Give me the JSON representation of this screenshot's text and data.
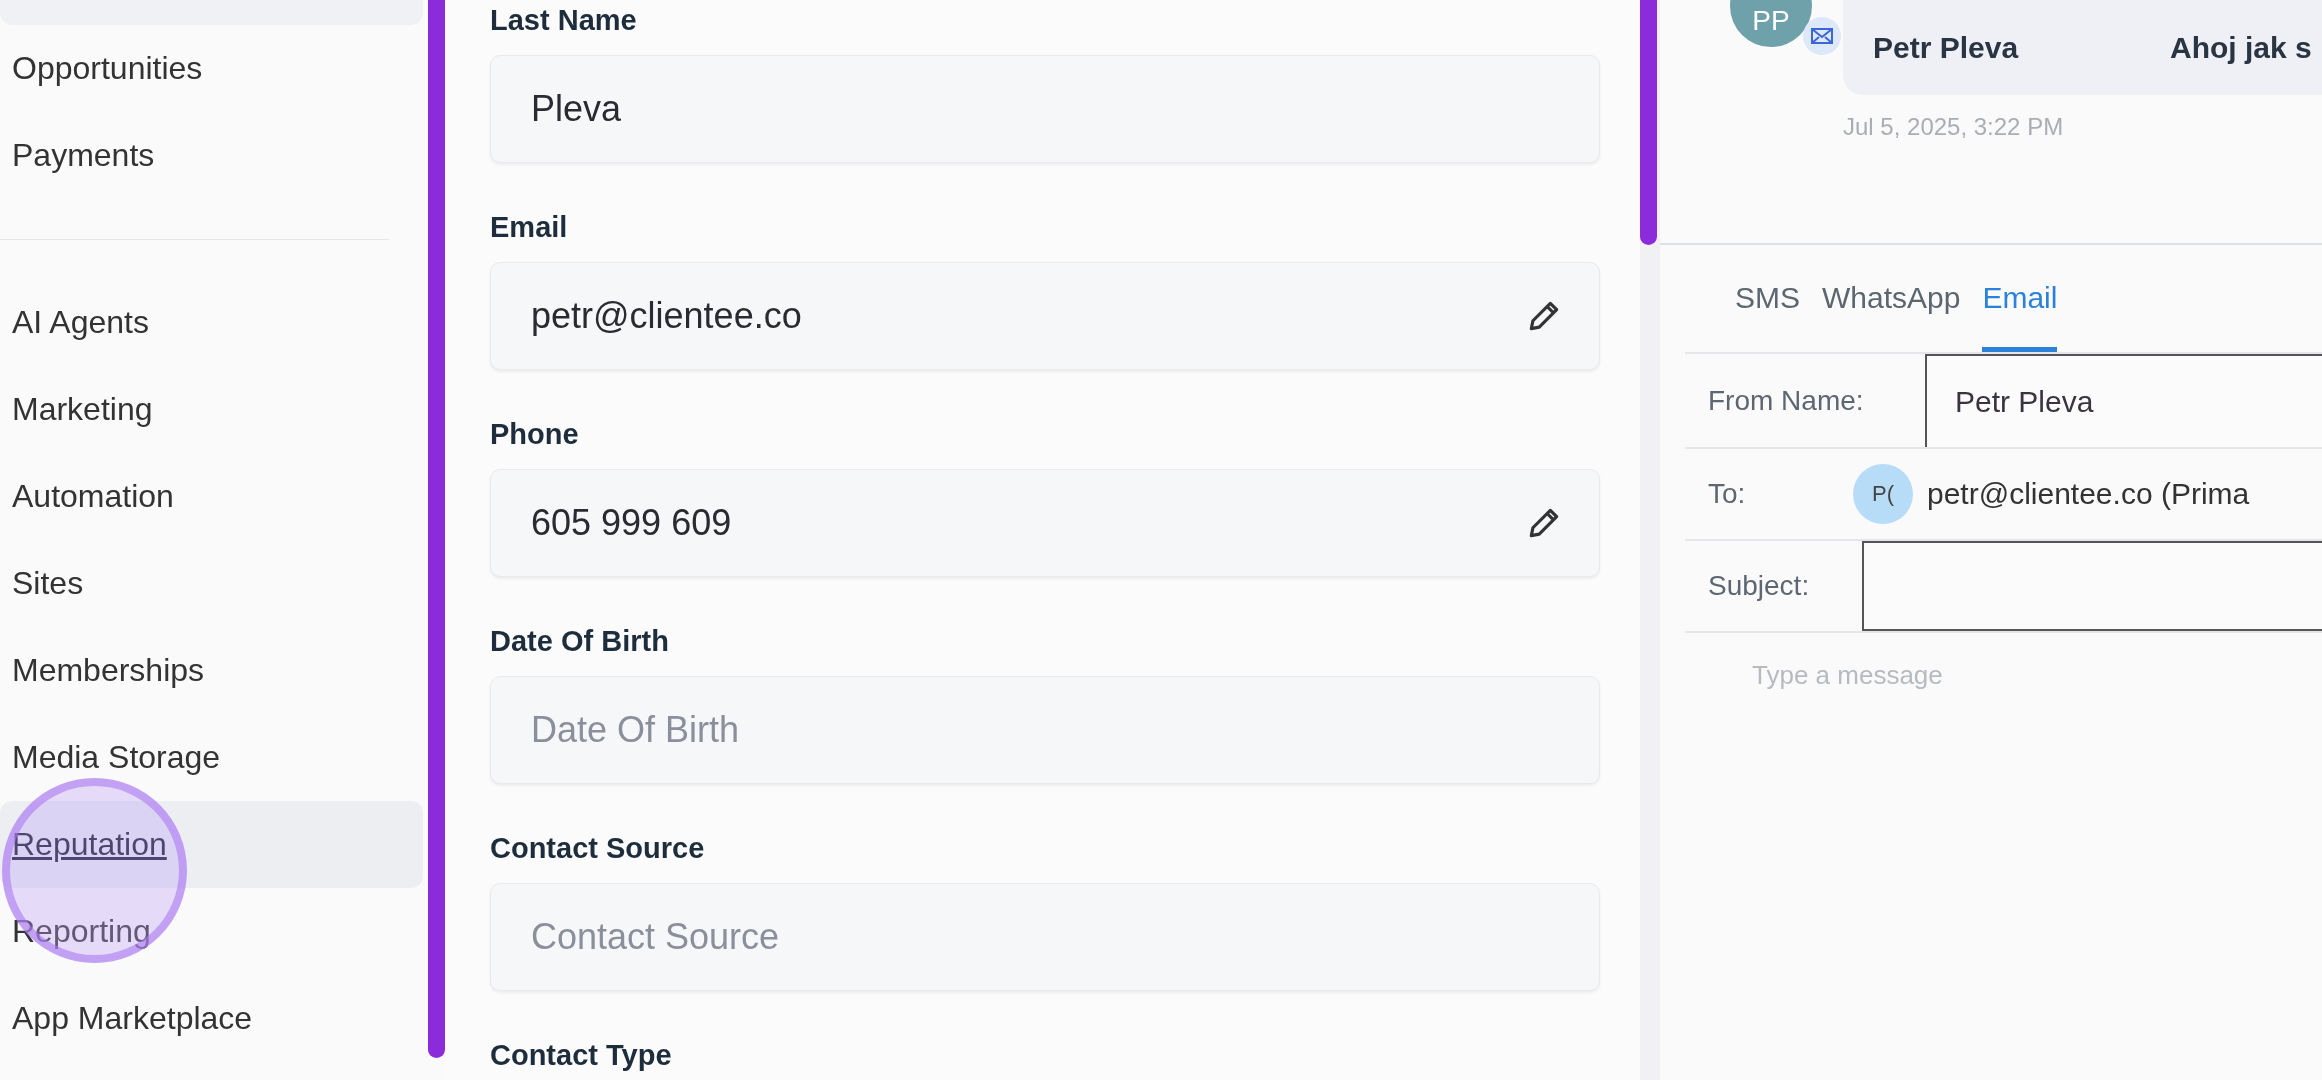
{
  "sidebar": {
    "items": [
      {
        "label": "Opportunities",
        "selected": false
      },
      {
        "label": "Payments",
        "selected": false
      },
      {
        "kind": "divider"
      },
      {
        "label": "AI Agents",
        "selected": false
      },
      {
        "label": "Marketing",
        "selected": false
      },
      {
        "label": "Automation",
        "selected": false
      },
      {
        "label": "Sites",
        "selected": false
      },
      {
        "label": "Memberships",
        "selected": false
      },
      {
        "label": "Media Storage",
        "selected": false
      },
      {
        "label": "Reputation",
        "selected": true
      },
      {
        "label": "Reporting",
        "selected": false
      },
      {
        "label": "App Marketplace",
        "selected": false
      }
    ]
  },
  "contact_form": {
    "fields": [
      {
        "label": "Last Name",
        "value": "Pleva",
        "editable": false
      },
      {
        "label": "Email",
        "value": "petr@clientee.co",
        "editable": true
      },
      {
        "label": "Phone",
        "value": "605 999 609",
        "editable": true
      },
      {
        "label": "Date Of Birth",
        "placeholder": "Date Of Birth",
        "editable": false
      },
      {
        "label": "Contact Source",
        "placeholder": "Contact Source",
        "editable": false
      },
      {
        "label": "Contact Type"
      }
    ]
  },
  "conversation": {
    "message": {
      "avatar": "PP",
      "sender": "Petr Pleva",
      "text": "Ahoj jak s",
      "time": "Jul 5, 2025, 3:22 PM"
    },
    "tabs": [
      {
        "label": "SMS",
        "selected": false
      },
      {
        "label": "WhatsApp",
        "selected": false
      },
      {
        "label": "Email",
        "selected": true
      }
    ],
    "from_name": {
      "label": "From Name:",
      "value": "Petr Pleva"
    },
    "to": {
      "label": "To:",
      "avatar": "P(",
      "value": "petr@clientee.co (Prima"
    },
    "subject": {
      "label": "Subject:"
    },
    "message_box": {
      "placeholder": "Type a message"
    }
  }
}
